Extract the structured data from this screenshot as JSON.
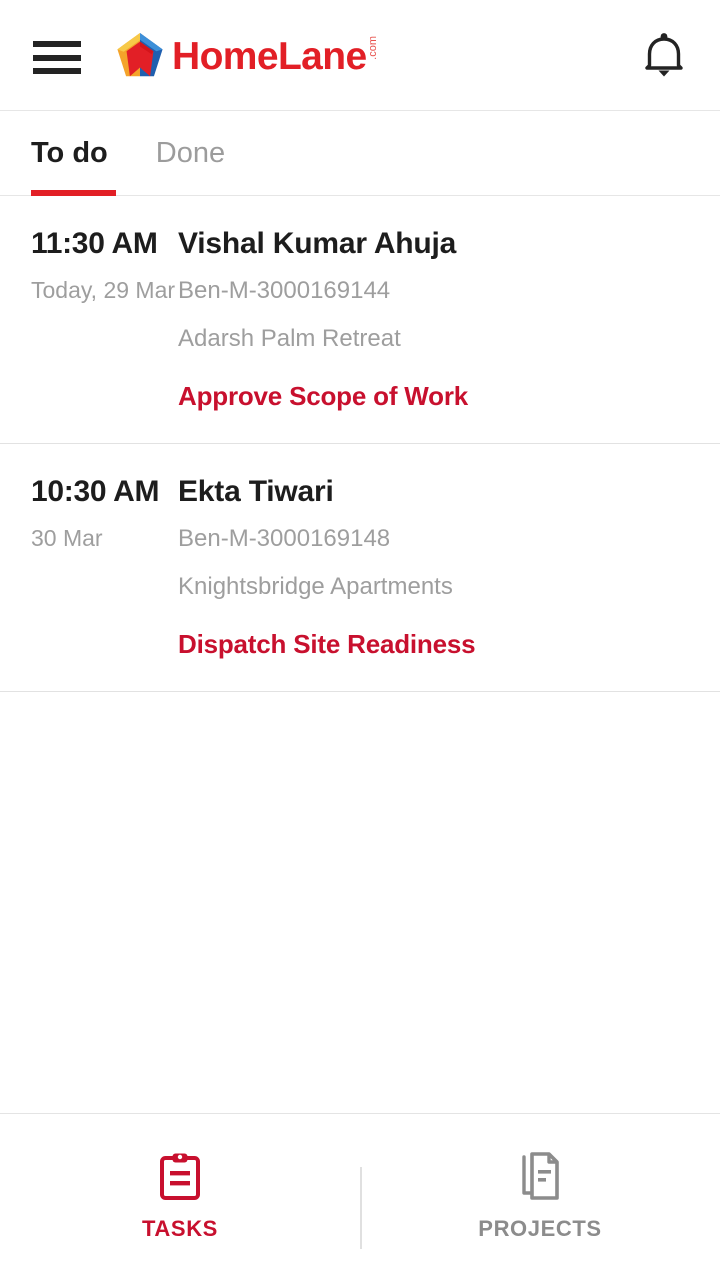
{
  "header": {
    "menu_label": "menu",
    "brand_name": "HomeLane",
    "brand_tld": ".com",
    "notifications_label": "notifications"
  },
  "tabs": [
    {
      "label": "To do",
      "active": true
    },
    {
      "label": "Done",
      "active": false
    }
  ],
  "tasks": [
    {
      "time": "11:30 AM",
      "date": "Today, 29 Mar",
      "customer": "Vishal Kumar Ahuja",
      "reference": "Ben-M-3000169144",
      "property": "Adarsh Palm Retreat",
      "action": "Approve Scope of Work"
    },
    {
      "time": "10:30 AM",
      "date": "30 Mar",
      "customer": "Ekta Tiwari",
      "reference": "Ben-M-3000169148",
      "property": "Knightsbridge Apartments",
      "action": "Dispatch Site Readiness"
    }
  ],
  "bottom_nav": [
    {
      "label": "TASKS",
      "icon": "clipboard-icon",
      "active": true
    },
    {
      "label": "PROJECTS",
      "icon": "documents-icon",
      "active": false
    }
  ],
  "colors": {
    "brand_red": "#E21F26",
    "action_red": "#C8102E",
    "text_dark": "#1d1d1d",
    "text_muted": "#9e9e9e",
    "divider": "#e2e2e2"
  }
}
